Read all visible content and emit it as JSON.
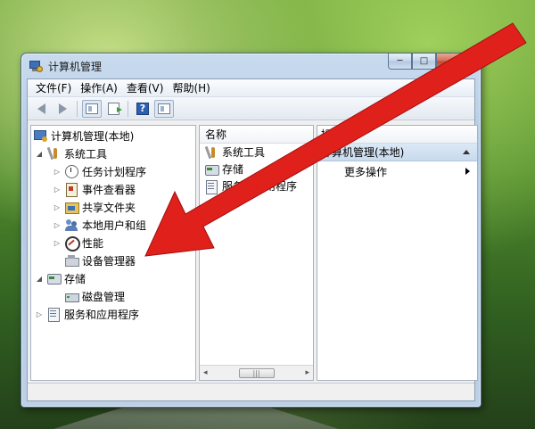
{
  "window": {
    "title": "计算机管理",
    "controls": {
      "minimize": "─",
      "maximize": "□",
      "close": "✕"
    }
  },
  "menu": [
    "文件(F)",
    "操作(A)",
    "查看(V)",
    "帮助(H)"
  ],
  "toolbar": {
    "icons": [
      "back-icon",
      "forward-icon",
      "show-hide-tree-icon",
      "export-list-icon",
      "help-icon",
      "properties-icon"
    ],
    "help_glyph": "?"
  },
  "tree": {
    "root": "计算机管理(本地)",
    "items": [
      {
        "label": "系统工具",
        "expander": "◢",
        "icon": "tools-icon",
        "level": 1
      },
      {
        "label": "任务计划程序",
        "expander": "▷",
        "icon": "clock-icon",
        "level": 2
      },
      {
        "label": "事件查看器",
        "expander": "▷",
        "icon": "event-viewer-icon",
        "level": 2
      },
      {
        "label": "共享文件夹",
        "expander": "▷",
        "icon": "shared-folder-icon",
        "level": 2
      },
      {
        "label": "本地用户和组",
        "expander": "▷",
        "icon": "users-icon",
        "level": 2
      },
      {
        "label": "性能",
        "expander": "▷",
        "icon": "performance-icon",
        "level": 2
      },
      {
        "label": "设备管理器",
        "expander": "",
        "icon": "device-manager-icon",
        "level": 2
      },
      {
        "label": "存储",
        "expander": "◢",
        "icon": "storage-icon",
        "level": 1
      },
      {
        "label": "磁盘管理",
        "expander": "",
        "icon": "disk-icon",
        "level": 2
      },
      {
        "label": "服务和应用程序",
        "expander": "▷",
        "icon": "services-icon",
        "level": 1
      }
    ]
  },
  "list": {
    "column_header": "名称",
    "rows": [
      {
        "label": "系统工具",
        "icon": "tools-icon"
      },
      {
        "label": "存储",
        "icon": "storage-icon"
      },
      {
        "label": "服务和应用程序",
        "icon": "services-icon"
      }
    ],
    "scrollbar": {
      "left": "◂",
      "thumb": "|||",
      "right": "▸"
    }
  },
  "actions": {
    "header": "操作",
    "section": "计算机管理(本地)",
    "items": [
      "更多操作"
    ]
  },
  "colors": {
    "annotation_arrow": "#e0201a"
  }
}
